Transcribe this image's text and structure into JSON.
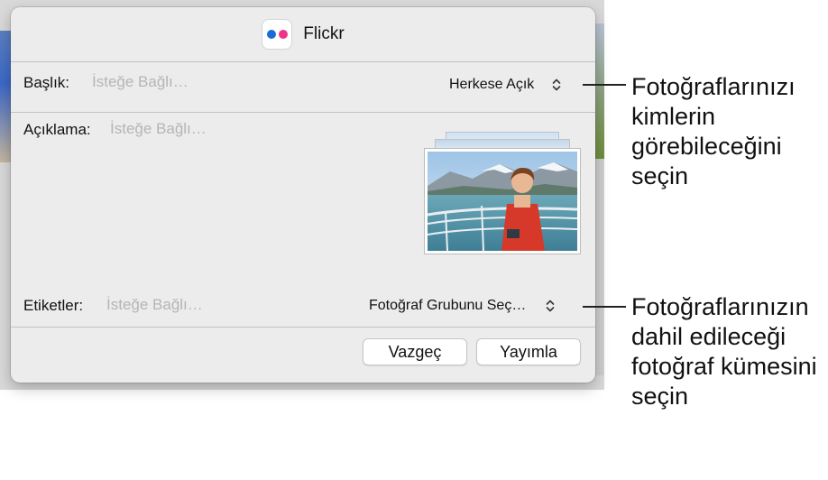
{
  "dialog": {
    "title": "Flickr",
    "icon": "flickr-logo-icon",
    "title_field": {
      "label": "Başlık:",
      "placeholder": "İsteğe Bağlı…"
    },
    "privacy_popup": {
      "value": "Herkese Açık",
      "icon": "up-down-chevron-icon"
    },
    "description_field": {
      "label": "Açıklama:",
      "placeholder": "İsteğe Bağlı…"
    },
    "tags_field": {
      "label": "Etiketler:",
      "placeholder": "İsteğe Bağlı…"
    },
    "group_popup": {
      "value": "Fotoğraf Grubunu Seç…",
      "icon": "up-down-chevron-icon"
    },
    "cancel_label": "Vazgeç",
    "publish_label": "Yayımla"
  },
  "callouts": {
    "privacy": "Fotoğraflarınızı kimlerin görebileceğini seçin",
    "group": "Fotoğraflarınızın dahil edileceği fotoğraf kümesini seçin"
  },
  "colors": {
    "flickr_blue": "#1a6bd8",
    "flickr_pink": "#f0328a",
    "placeholder": "#b5b5b5",
    "dialog_bg": "#ececec"
  }
}
